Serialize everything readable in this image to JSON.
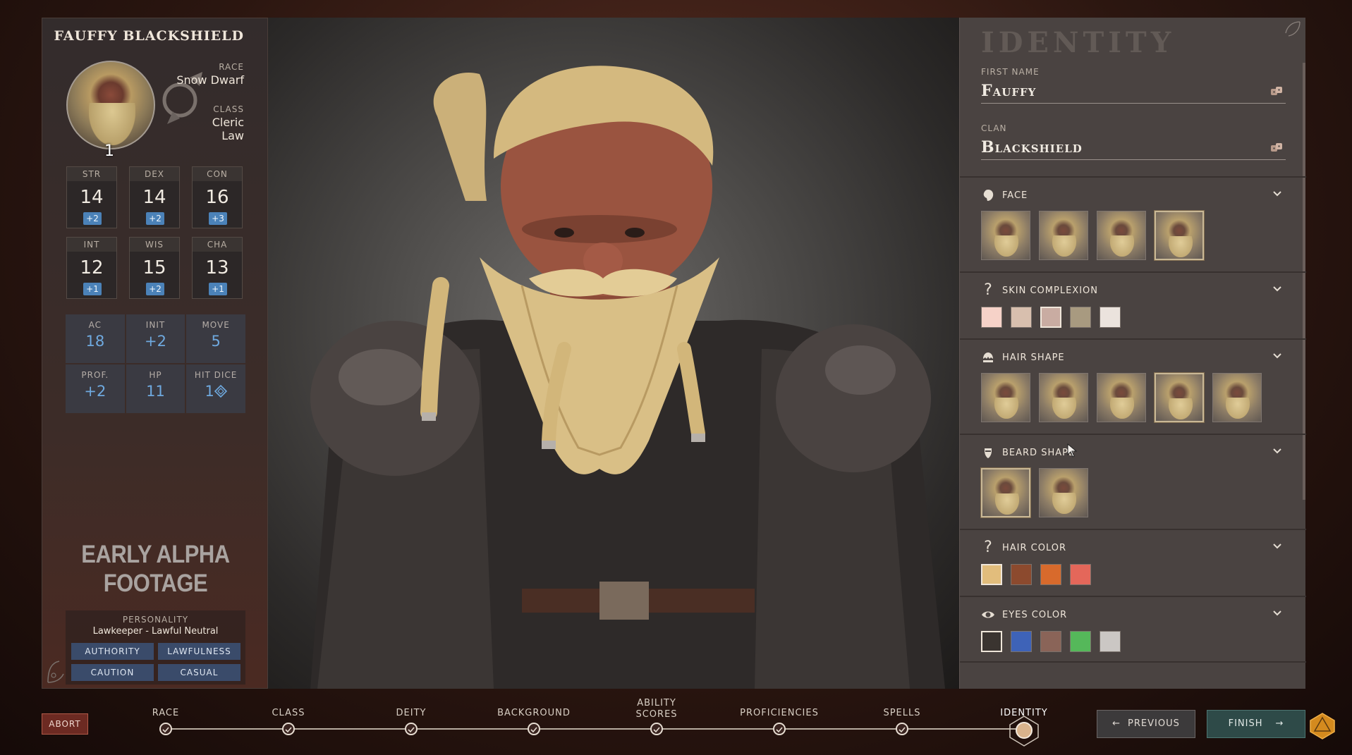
{
  "character": {
    "name": "Fauffy Blackshield",
    "level": "1",
    "race_label": "RACE",
    "race": "Snow Dwarf",
    "class_label": "CLASS",
    "class_line1": "Cleric",
    "class_line2": "Law"
  },
  "abilities": [
    {
      "abbr": "STR",
      "score": "14",
      "mod": "+2"
    },
    {
      "abbr": "DEX",
      "score": "14",
      "mod": "+2"
    },
    {
      "abbr": "CON",
      "score": "16",
      "mod": "+3"
    },
    {
      "abbr": "INT",
      "score": "12",
      "mod": "+1"
    },
    {
      "abbr": "WIS",
      "score": "15",
      "mod": "+2"
    },
    {
      "abbr": "CHA",
      "score": "13",
      "mod": "+1"
    }
  ],
  "derived": [
    {
      "label": "AC",
      "value": "18"
    },
    {
      "label": "INIT",
      "value": "+2"
    },
    {
      "label": "MOVE",
      "value": "5"
    },
    {
      "label": "PROF.",
      "value": "+2"
    },
    {
      "label": "HP",
      "value": "11"
    },
    {
      "label": "HIT DICE",
      "value": "1"
    }
  ],
  "watermark": "EARLY ALPHA FOOTAGE",
  "personality": {
    "title": "PERSONALITY",
    "value": "Lawkeeper - Lawful Neutral",
    "tags": [
      "AUTHORITY",
      "LAWFULNESS",
      "CAUTION",
      "CASUAL"
    ]
  },
  "identity": {
    "title": "IDENTITY",
    "first_name_label": "FIRST NAME",
    "first_name": "Fauffy",
    "clan_label": "CLAN",
    "clan": "Blackshield",
    "sections": {
      "face": "FACE",
      "skin": "SKIN COMPLEXION",
      "hair_shape": "HAIR SHAPE",
      "beard_shape": "BEARD SHAPE",
      "hair_color": "HAIR COLOR",
      "eyes_color": "EYES COLOR"
    },
    "skin_colors": [
      "#f6d2c8",
      "#d8bfae",
      "#c9aca2",
      "#a89a80",
      "#ebe3dd"
    ],
    "hair_colors": [
      "#e2bd7c",
      "#8c4a2e",
      "#d86a2c",
      "#e4675a"
    ],
    "eye_colors": [
      "#3a3430",
      "#3e63b8",
      "#8a6458",
      "#55b85a",
      "#cbc7c4"
    ]
  },
  "footer": {
    "abort": "ABORT",
    "steps": [
      "RACE",
      "CLASS",
      "DEITY",
      "BACKGROUND",
      "ABILITY SCORES",
      "PROFICIENCIES",
      "SPELLS",
      "IDENTITY"
    ],
    "previous": "PREVIOUS",
    "finish": "FINISH"
  },
  "colors": {
    "accent_blue": "#4b82b8",
    "stat_value_blue": "#6fa9df",
    "abort_red": "#6c2a22",
    "finish_teal": "#2e4a48"
  }
}
